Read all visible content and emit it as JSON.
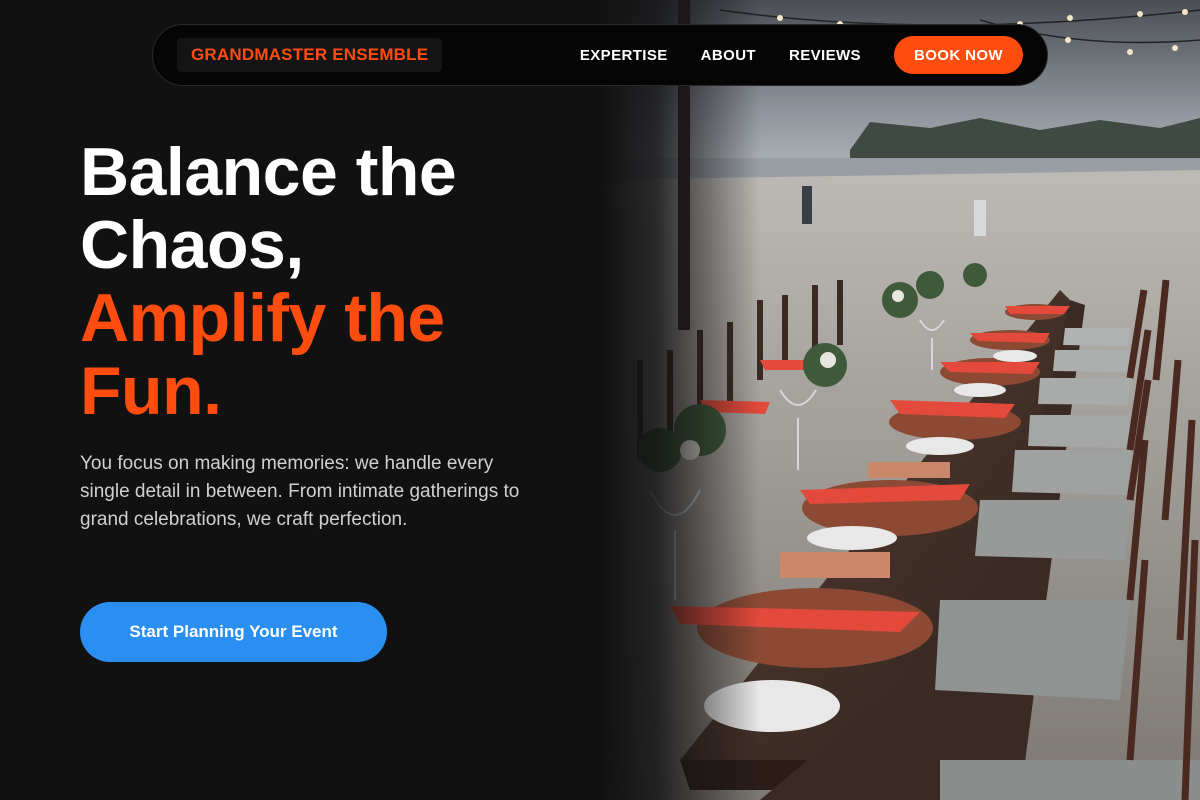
{
  "nav": {
    "brand": "GRANDMASTER ENSEMBLE",
    "links": [
      "EXPERTISE",
      "ABOUT",
      "REVIEWS"
    ],
    "cta": "BOOK NOW"
  },
  "hero": {
    "title_lines": [
      "Balance the",
      "Chaos,"
    ],
    "accent_lines": [
      "Amplify the",
      "Fun."
    ],
    "description": "You focus on making memories: we handle every single detail in between. From intimate gatherings to grand celebrations, we craft perfection.",
    "cta": "Start Planning Your Event"
  },
  "colors": {
    "background": "#111112",
    "accent": "#ff4d0f",
    "cta_blue": "#2b8ff2"
  },
  "image": {
    "subject": "beach-banquet-table-photo"
  }
}
